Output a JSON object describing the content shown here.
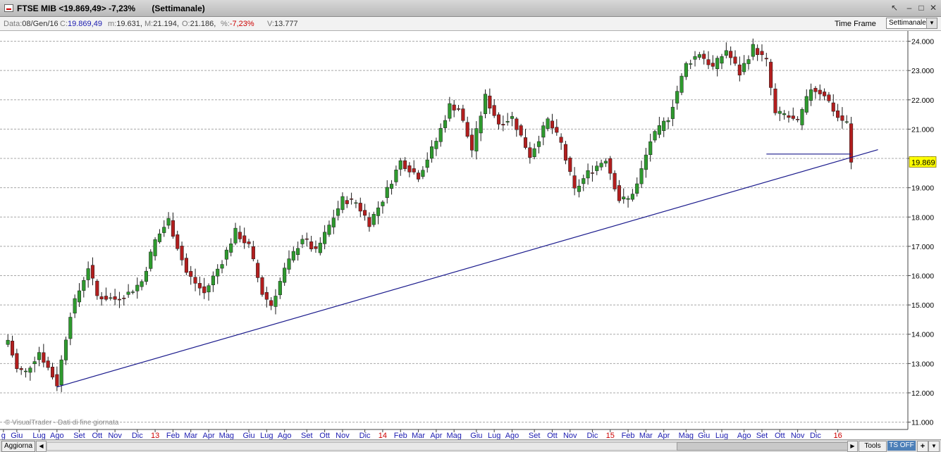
{
  "window": {
    "title": "FTSE MIB <19.869,49> -7,23%       (Settimanale)",
    "controls": [
      "↖",
      "–",
      "□",
      "✕"
    ]
  },
  "info": {
    "data_label": "Data:",
    "data_value": "08/Gen/16",
    "c_label": "C:",
    "c_value": "19.869,49",
    "m_label": "m:",
    "m_value": "19.631,",
    "M_label": "M:",
    "M_value": "21.194,",
    "O_label": "O:",
    "O_value": "21.186,",
    "pct_label": "%:",
    "pct_value": "-7,23%",
    "V_label": "V:",
    "V_value": "13.777"
  },
  "timeframe": {
    "label": "Time Frame",
    "value": "Settimanale"
  },
  "watermark": "© VisualTrader - Dati di fine giornata",
  "bottom": {
    "aggiorna": "Aggiorna",
    "tools": "Tools",
    "ts_off": "TS OFF",
    "plus": "+"
  },
  "colors": {
    "up": "#2e9a2e",
    "down": "#b21e1e",
    "trend": "#1a1a8c",
    "price_tag": "#ffff00",
    "year_label": "#cc0000",
    "month_label": "#1b1bb0"
  },
  "chart_data": {
    "type": "candlestick",
    "title": "FTSE MIB",
    "ylim": [
      10750,
      24350
    ],
    "yticks": [
      11000,
      12000,
      13000,
      14000,
      15000,
      16000,
      17000,
      18000,
      19000,
      20000,
      21000,
      22000,
      23000,
      24000
    ],
    "ytick_labels": [
      "11.000",
      "12.000",
      "13.000",
      "14.000",
      "15.000",
      "16.000",
      "17.000",
      "18.000",
      "19.000",
      "20.000",
      "21.000",
      "22.000",
      "23.000",
      "24.000"
    ],
    "last_price": 19869.49,
    "last_price_label": "19.869",
    "x_labels": [
      {
        "text": "g",
        "bar": -1,
        "year": false
      },
      {
        "text": "Giu",
        "bar": 2,
        "year": false
      },
      {
        "text": "Lug",
        "bar": 7,
        "year": false
      },
      {
        "text": "Ago",
        "bar": 11,
        "year": false
      },
      {
        "text": "Set",
        "bar": 16,
        "year": false
      },
      {
        "text": "Ott",
        "bar": 20,
        "year": false
      },
      {
        "text": "Nov",
        "bar": 24,
        "year": false
      },
      {
        "text": "Dic",
        "bar": 29,
        "year": false
      },
      {
        "text": "13",
        "bar": 33,
        "year": true
      },
      {
        "text": "Feb",
        "bar": 37,
        "year": false
      },
      {
        "text": "Mar",
        "bar": 41,
        "year": false
      },
      {
        "text": "Apr",
        "bar": 45,
        "year": false
      },
      {
        "text": "Mag",
        "bar": 49,
        "year": false
      },
      {
        "text": "Giu",
        "bar": 54,
        "year": false
      },
      {
        "text": "Lug",
        "bar": 58,
        "year": false
      },
      {
        "text": "Ago",
        "bar": 62,
        "year": false
      },
      {
        "text": "Set",
        "bar": 67,
        "year": false
      },
      {
        "text": "Ott",
        "bar": 71,
        "year": false
      },
      {
        "text": "Nov",
        "bar": 75,
        "year": false
      },
      {
        "text": "Dic",
        "bar": 80,
        "year": false
      },
      {
        "text": "14",
        "bar": 84,
        "year": true
      },
      {
        "text": "Feb",
        "bar": 88,
        "year": false
      },
      {
        "text": "Mar",
        "bar": 92,
        "year": false
      },
      {
        "text": "Apr",
        "bar": 96,
        "year": false
      },
      {
        "text": "Mag",
        "bar": 100,
        "year": false
      },
      {
        "text": "Giu",
        "bar": 105,
        "year": false
      },
      {
        "text": "Lug",
        "bar": 109,
        "year": false
      },
      {
        "text": "Ago",
        "bar": 113,
        "year": false
      },
      {
        "text": "Set",
        "bar": 118,
        "year": false
      },
      {
        "text": "Ott",
        "bar": 122,
        "year": false
      },
      {
        "text": "Nov",
        "bar": 126,
        "year": false
      },
      {
        "text": "Dic",
        "bar": 131,
        "year": false
      },
      {
        "text": "15",
        "bar": 135,
        "year": true
      },
      {
        "text": "Feb",
        "bar": 139,
        "year": false
      },
      {
        "text": "Mar",
        "bar": 143,
        "year": false
      },
      {
        "text": "Apr",
        "bar": 147,
        "year": false
      },
      {
        "text": "Mag",
        "bar": 152,
        "year": false
      },
      {
        "text": "Giu",
        "bar": 156,
        "year": false
      },
      {
        "text": "Lug",
        "bar": 160,
        "year": false
      },
      {
        "text": "Ago",
        "bar": 165,
        "year": false
      },
      {
        "text": "Set",
        "bar": 169,
        "year": false
      },
      {
        "text": "Ott",
        "bar": 173,
        "year": false
      },
      {
        "text": "Nov",
        "bar": 177,
        "year": false
      },
      {
        "text": "Dic",
        "bar": 181,
        "year": false
      },
      {
        "text": "16",
        "bar": 186,
        "year": true
      }
    ],
    "close_anchors": [
      [
        0,
        13800
      ],
      [
        2,
        12800
      ],
      [
        4,
        12700
      ],
      [
        7,
        13400
      ],
      [
        11,
        12300
      ],
      [
        14,
        14700
      ],
      [
        18,
        16300
      ],
      [
        20,
        15300
      ],
      [
        24,
        15200
      ],
      [
        27,
        15400
      ],
      [
        30,
        15800
      ],
      [
        33,
        17200
      ],
      [
        36,
        17900
      ],
      [
        40,
        16100
      ],
      [
        44,
        15400
      ],
      [
        48,
        16500
      ],
      [
        51,
        17500
      ],
      [
        54,
        17000
      ],
      [
        57,
        15400
      ],
      [
        59,
        15000
      ],
      [
        62,
        16200
      ],
      [
        66,
        17300
      ],
      [
        69,
        16800
      ],
      [
        72,
        17700
      ],
      [
        75,
        18600
      ],
      [
        78,
        18500
      ],
      [
        81,
        17800
      ],
      [
        84,
        18600
      ],
      [
        88,
        19900
      ],
      [
        92,
        19400
      ],
      [
        96,
        20600
      ],
      [
        99,
        21800
      ],
      [
        101,
        21700
      ],
      [
        104,
        20300
      ],
      [
        107,
        22100
      ],
      [
        110,
        21200
      ],
      [
        113,
        21400
      ],
      [
        117,
        20100
      ],
      [
        121,
        21300
      ],
      [
        124,
        20500
      ],
      [
        127,
        18900
      ],
      [
        130,
        19500
      ],
      [
        134,
        20000
      ],
      [
        137,
        18600
      ],
      [
        139,
        18600
      ],
      [
        141,
        19100
      ],
      [
        144,
        20600
      ],
      [
        148,
        21400
      ],
      [
        152,
        23200
      ],
      [
        155,
        23600
      ],
      [
        158,
        23100
      ],
      [
        161,
        23700
      ],
      [
        164,
        22900
      ],
      [
        167,
        23800
      ],
      [
        170,
        23300
      ],
      [
        172,
        21500
      ],
      [
        174,
        21500
      ],
      [
        177,
        21200
      ],
      [
        180,
        22400
      ],
      [
        183,
        22200
      ],
      [
        186,
        21400
      ],
      [
        188,
        21200
      ],
      [
        189,
        19869
      ]
    ],
    "trendline": {
      "from": [
        11,
        12200
      ],
      "to": [
        195,
        20300
      ]
    },
    "support_line": {
      "from_bar": 170,
      "to_bar": 189,
      "value": 20150
    }
  }
}
